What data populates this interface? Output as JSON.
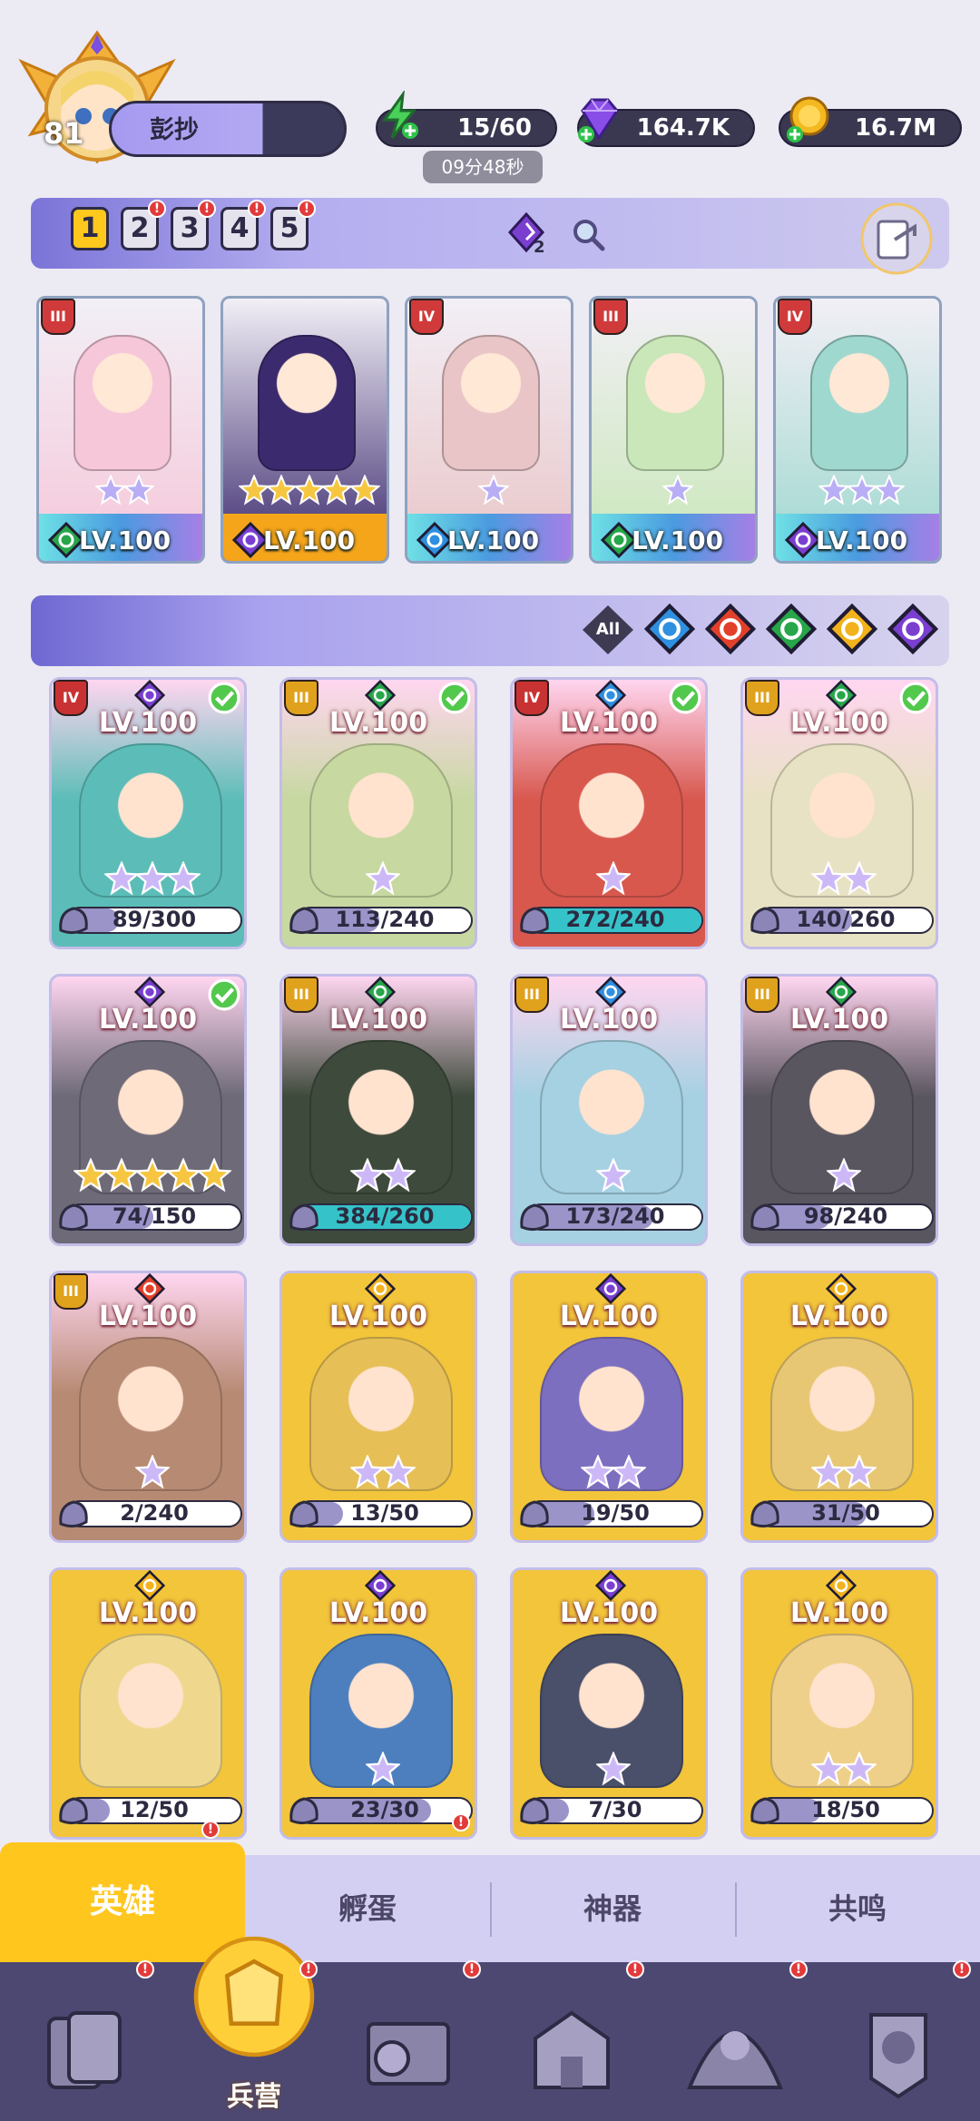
{
  "player": {
    "level": "81",
    "name": "彭抄"
  },
  "resources": {
    "energy": "15/60",
    "energy_timer": "09分48秒",
    "gems": "164.7K",
    "gold": "16.7M"
  },
  "team": {
    "slots": [
      {
        "label": "1",
        "selected": true,
        "alert": false
      },
      {
        "label": "2",
        "selected": false,
        "alert": true
      },
      {
        "label": "3",
        "selected": false,
        "alert": true
      },
      {
        "label": "4",
        "selected": false,
        "alert": true
      },
      {
        "label": "5",
        "selected": false,
        "alert": true
      }
    ],
    "gem_count": "2",
    "alert_mark": "!",
    "members": [
      {
        "rank": "III",
        "level": "LV.100",
        "stars": 2,
        "element": "nature",
        "color": "#f6c7d9"
      },
      {
        "rank": "",
        "level": "LV.100",
        "stars": 5,
        "element": "dark",
        "color": "#3b2a6e"
      },
      {
        "rank": "IV",
        "level": "LV.100",
        "stars": 1,
        "element": "water",
        "color": "#e9c5c7"
      },
      {
        "rank": "III",
        "level": "LV.100",
        "stars": 1,
        "element": "nature",
        "color": "#c9e7b8"
      },
      {
        "rank": "IV",
        "level": "LV.100",
        "stars": 3,
        "element": "dark",
        "color": "#9fd8cf"
      }
    ]
  },
  "filters": {
    "all_label": "All",
    "elements": [
      "water",
      "fire",
      "nature",
      "light",
      "dark"
    ]
  },
  "heroes": [
    {
      "rank": "IV",
      "element": "dark",
      "level": "LV.100",
      "stars": 3,
      "progress": "89/300",
      "checked": true,
      "color": "#5cbdb8"
    },
    {
      "rank": "III",
      "element": "nature",
      "level": "LV.100",
      "stars": 1,
      "progress": "113/240",
      "checked": true,
      "color": "#c7d8a1"
    },
    {
      "rank": "IV",
      "element": "water",
      "level": "LV.100",
      "stars": 1,
      "progress": "272/240",
      "checked": true,
      "color": "#d8584e"
    },
    {
      "rank": "III",
      "element": "nature",
      "level": "LV.100",
      "stars": 2,
      "progress": "140/260",
      "checked": true,
      "color": "#e8e2c4"
    },
    {
      "rank": "",
      "element": "dark",
      "level": "LV.100",
      "stars": 5,
      "progress": "74/150",
      "checked": true,
      "color": "#6e6a78"
    },
    {
      "rank": "III",
      "element": "nature",
      "level": "LV.100",
      "stars": 2,
      "progress": "384/260",
      "checked": false,
      "color": "#3e4a3c"
    },
    {
      "rank": "III",
      "element": "water",
      "level": "LV.100",
      "stars": 1,
      "progress": "173/240",
      "checked": false,
      "color": "#a5d1e2"
    },
    {
      "rank": "III",
      "element": "nature",
      "level": "LV.100",
      "stars": 1,
      "progress": "98/240",
      "checked": false,
      "color": "#5a5660"
    },
    {
      "rank": "III",
      "element": "fire",
      "level": "LV.100",
      "stars": 1,
      "progress": "2/240",
      "checked": false,
      "color": "#b78a73"
    },
    {
      "rank": "",
      "element": "light",
      "level": "LV.100",
      "stars": 2,
      "progress": "13/50",
      "checked": false,
      "color": "#e6bf56"
    },
    {
      "rank": "",
      "element": "dark",
      "level": "LV.100",
      "stars": 2,
      "progress": "19/50",
      "checked": false,
      "color": "#7d6fbf"
    },
    {
      "rank": "",
      "element": "light",
      "level": "LV.100",
      "stars": 2,
      "progress": "31/50",
      "checked": false,
      "color": "#e8c774"
    },
    {
      "rank": "",
      "element": "light",
      "level": "LV.100",
      "stars": 0,
      "progress": "12/50",
      "checked": false,
      "color": "#efd88e"
    },
    {
      "rank": "",
      "element": "dark",
      "level": "LV.100",
      "stars": 1,
      "progress": "23/30",
      "checked": false,
      "color": "#4d7fbe"
    },
    {
      "rank": "",
      "element": "dark",
      "level": "LV.100",
      "stars": 1,
      "progress": "7/30",
      "checked": false,
      "color": "#4a4f6a"
    },
    {
      "rank": "",
      "element": "light",
      "level": "LV.100",
      "stars": 2,
      "progress": "18/50",
      "checked": false,
      "color": "#efd08a"
    }
  ],
  "tabs": {
    "items": [
      {
        "label": "英雄",
        "active": true,
        "alert": true
      },
      {
        "label": "孵蛋",
        "active": false,
        "alert": true
      },
      {
        "label": "神器",
        "active": false,
        "alert": false
      },
      {
        "label": "共鸣",
        "active": false,
        "alert": false
      }
    ]
  },
  "nav": {
    "items": [
      {
        "name": "cards-nav",
        "label": "",
        "alert": true,
        "active": false
      },
      {
        "name": "barracks-nav",
        "label": "兵营",
        "alert": true,
        "active": true
      },
      {
        "name": "map-nav",
        "label": "",
        "alert": true,
        "active": false
      },
      {
        "name": "castle-nav",
        "label": "",
        "alert": true,
        "active": false
      },
      {
        "name": "summon-nav",
        "label": "",
        "alert": true,
        "active": false
      },
      {
        "name": "guild-nav",
        "label": "",
        "alert": true,
        "active": false
      }
    ]
  },
  "element_colors": {
    "water": "#2f8fe0",
    "fire": "#e2402a",
    "nature": "#27a64a",
    "light": "#f1b21c",
    "dark": "#7a3fd0"
  }
}
